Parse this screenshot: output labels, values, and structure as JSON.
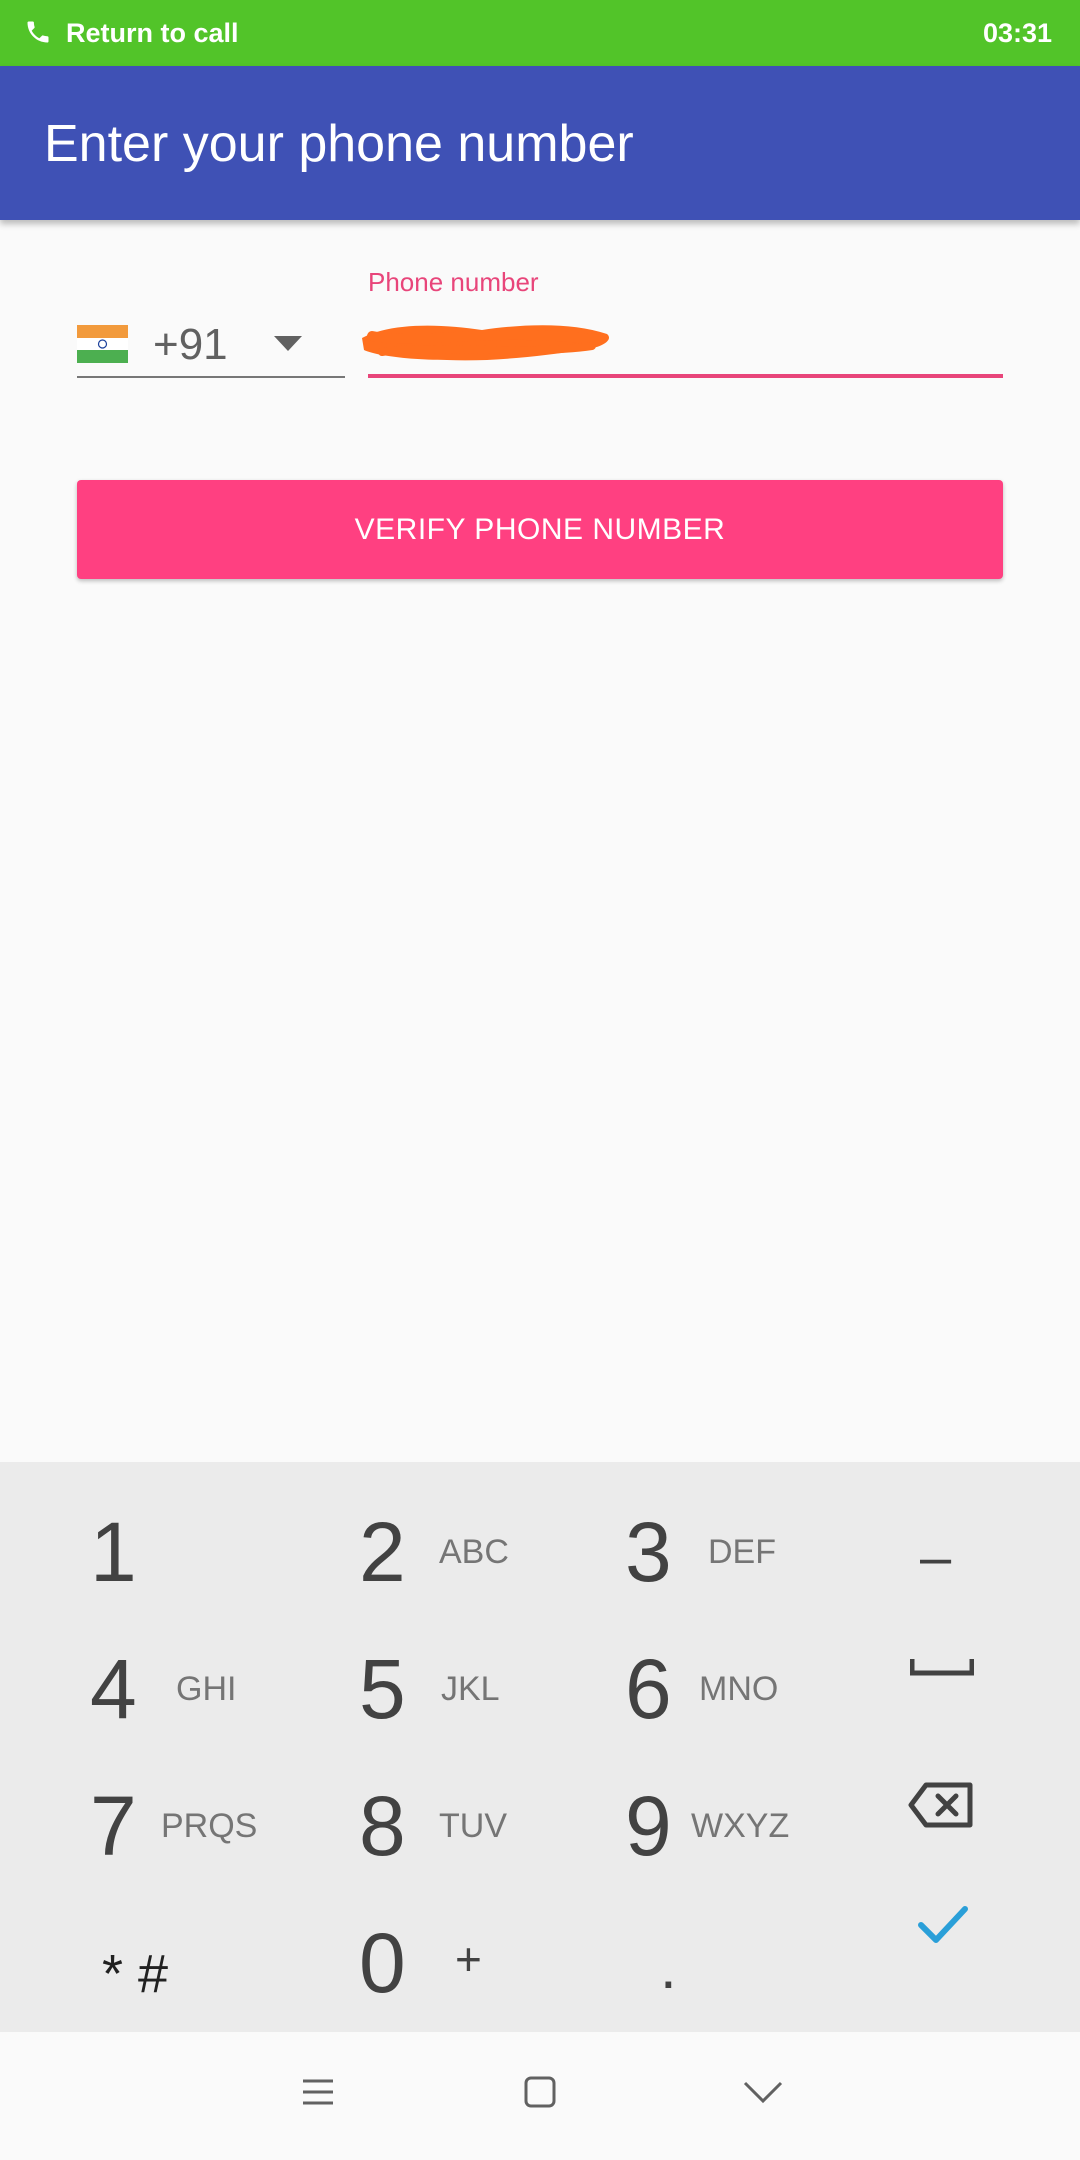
{
  "status_bar": {
    "return_label": "Return to call",
    "time": "03:31"
  },
  "app_bar": {
    "title": "Enter your phone number"
  },
  "country": {
    "flag_icon": "india-flag-icon",
    "code": "+91"
  },
  "phone_field": {
    "label": "Phone number",
    "value": ""
  },
  "verify_button": {
    "label": "VERIFY PHONE NUMBER"
  },
  "keypad": {
    "keys": [
      {
        "digit": "1",
        "letters": ""
      },
      {
        "digit": "2",
        "letters": "ABC"
      },
      {
        "digit": "3",
        "letters": "DEF"
      },
      {
        "digit": "4",
        "letters": "GHI"
      },
      {
        "digit": "5",
        "letters": "JKL"
      },
      {
        "digit": "6",
        "letters": "MNO"
      },
      {
        "digit": "7",
        "letters": "PRQS"
      },
      {
        "digit": "8",
        "letters": "TUV"
      },
      {
        "digit": "9",
        "letters": "WXYZ"
      },
      {
        "digit": "0",
        "letters": "+"
      }
    ],
    "star_hash": "* #",
    "dash": "–",
    "dot": ".",
    "icons": [
      "space-icon",
      "backspace-icon",
      "done-check-icon"
    ]
  },
  "nav_bar": {
    "icons": [
      "menu-icon",
      "home-icon",
      "back-chevron-icon"
    ]
  },
  "colors": {
    "status_green": "#52c429",
    "primary": "#3f51b5",
    "accent": "#ff4081",
    "check_blue": "#2a9fd8"
  }
}
